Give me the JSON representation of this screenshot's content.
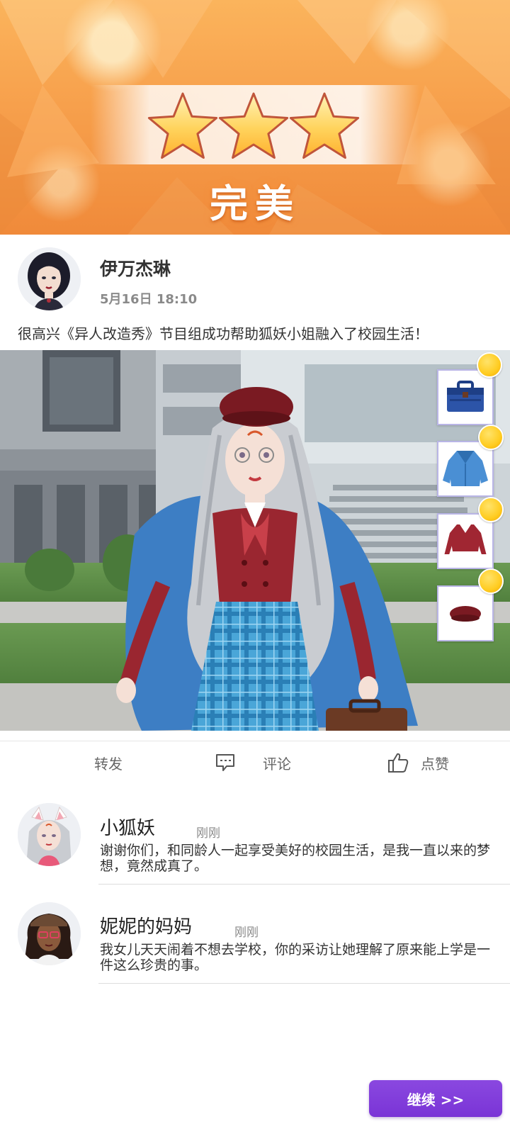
{
  "result": {
    "stars": 3,
    "rating_text": "完美"
  },
  "post": {
    "author": "伊万杰琳",
    "time": "5月16日 18:10",
    "text": "很高兴《异人改造秀》节目组成功帮助狐妖小姐融入了校园生活！"
  },
  "items": [
    {
      "name": "bag",
      "icon": "briefcase-icon",
      "reaction": "smiley"
    },
    {
      "name": "jacket",
      "icon": "jacket-icon",
      "reaction": "smiley"
    },
    {
      "name": "top",
      "icon": "blouse-icon",
      "reaction": "smiley"
    },
    {
      "name": "hat",
      "icon": "beret-icon",
      "reaction": "smiley"
    }
  ],
  "actions": {
    "share": "转发",
    "comment": "评论",
    "like": "点赞"
  },
  "comments": [
    {
      "author": "小狐妖",
      "time": "刚刚",
      "text": "谢谢你们，和同龄人一起享受美好的校园生活，是我一直以来的梦想，竟然成真了。"
    },
    {
      "author": "妮妮的妈妈",
      "time": "刚刚",
      "text": "我女儿天天闹着不想去学校，你的采访让她理解了原来能上学是一件这么珍贵的事。"
    }
  ],
  "continue_label": "继续 >>",
  "colors": {
    "accent": "#7a34d6",
    "banner": "#f7a04c",
    "star": "#ffc844",
    "card_border": "#b9b5e6"
  }
}
